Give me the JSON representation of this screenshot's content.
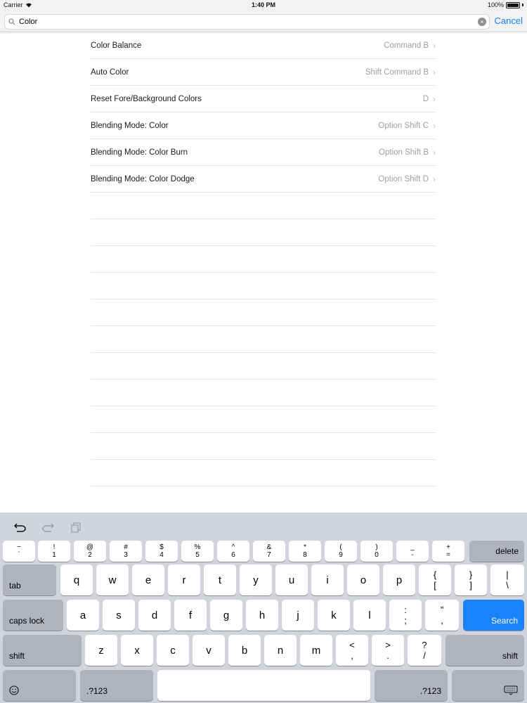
{
  "status_bar": {
    "carrier": "Carrier",
    "time": "1:40 PM",
    "battery": "100%"
  },
  "search": {
    "value": "Color",
    "cancel_label": "Cancel"
  },
  "results": [
    {
      "title": "Color Balance",
      "shortcut": "Command B"
    },
    {
      "title": "Auto Color",
      "shortcut": "Shift Command B"
    },
    {
      "title": "Reset Fore/Background Colors",
      "shortcut": "D"
    },
    {
      "title": "Blending Mode: Color",
      "shortcut": "Option Shift C"
    },
    {
      "title": "Blending Mode: Color Burn",
      "shortcut": "Option Shift B"
    },
    {
      "title": "Blending Mode: Color Dodge",
      "shortcut": "Option Shift D"
    }
  ],
  "keyboard": {
    "number_row": [
      {
        "top": "~",
        "bottom": "`"
      },
      {
        "top": "!",
        "bottom": "1"
      },
      {
        "top": "@",
        "bottom": "2"
      },
      {
        "top": "#",
        "bottom": "3"
      },
      {
        "top": "$",
        "bottom": "4"
      },
      {
        "top": "%",
        "bottom": "5"
      },
      {
        "top": "^",
        "bottom": "6"
      },
      {
        "top": "&",
        "bottom": "7"
      },
      {
        "top": "*",
        "bottom": "8"
      },
      {
        "top": "(",
        "bottom": "9"
      },
      {
        "top": ")",
        "bottom": "0"
      },
      {
        "top": "_",
        "bottom": "-"
      },
      {
        "top": "+",
        "bottom": "="
      }
    ],
    "delete_label": "delete",
    "tab_label": "tab",
    "row_q": [
      "q",
      "w",
      "e",
      "r",
      "t",
      "y",
      "u",
      "i",
      "o",
      "p"
    ],
    "row_q_extra": [
      {
        "top": "{",
        "bottom": "["
      },
      {
        "top": "}",
        "bottom": "]"
      },
      {
        "top": "|",
        "bottom": "\\"
      }
    ],
    "caps_label": "caps lock",
    "row_a": [
      "a",
      "s",
      "d",
      "f",
      "g",
      "h",
      "j",
      "k",
      "l"
    ],
    "row_a_extra": [
      {
        "top": ":",
        "bottom": ";"
      },
      {
        "top": "”",
        "bottom": ","
      }
    ],
    "search_label": "Search",
    "shift_label": "shift",
    "row_z": [
      "z",
      "x",
      "c",
      "v",
      "b",
      "n",
      "m"
    ],
    "row_z_extra": [
      {
        "top": "<",
        "bottom": ","
      },
      {
        "top": ">",
        "bottom": "."
      },
      {
        "top": "?",
        "bottom": "/"
      }
    ],
    "num_label": ".?123",
    "accent_color": "#1a82fb"
  },
  "icons": {
    "search": "search-icon",
    "clear": "clear-icon",
    "undo": "undo-icon",
    "redo": "redo-icon",
    "paste": "paste-icon",
    "emoji": "emoji-icon",
    "dismiss_keyboard": "keyboard-dismiss-icon",
    "wifi": "wifi-icon",
    "battery": "battery-icon"
  }
}
